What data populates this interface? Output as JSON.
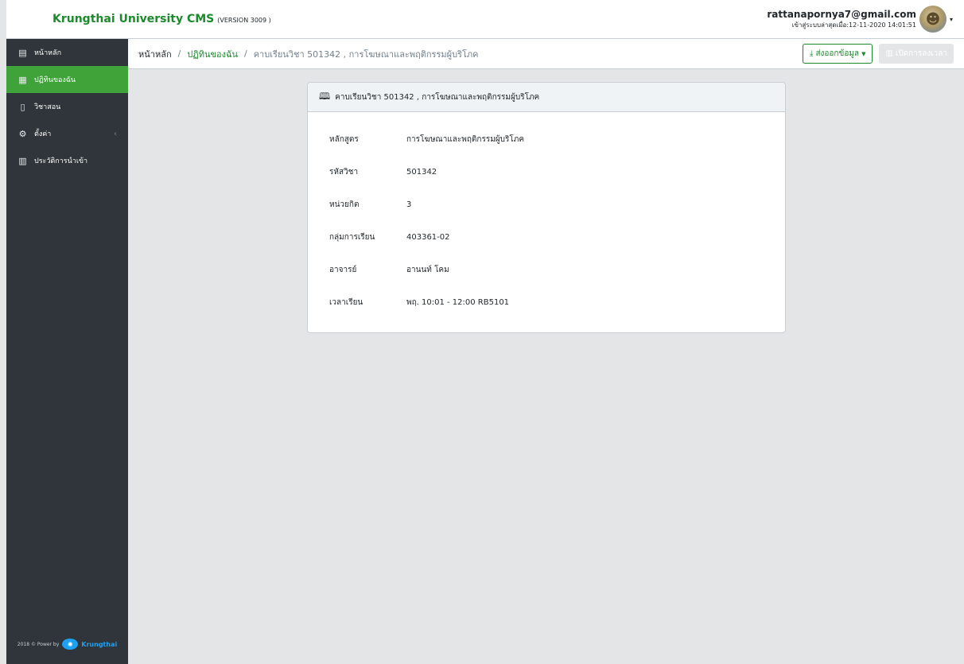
{
  "header": {
    "brand": "Krungthai University CMS",
    "version": "(VERSION 3009 )",
    "user_email": "rattanapornya7@gmail.com",
    "last_login": "เข้าสู่ระบบล่าสุดเมื่อ:12-11-2020 14:01:51",
    "avatar_icon": "user-avatar-icon",
    "caret": "▾"
  },
  "sidebar": {
    "items": [
      {
        "label": "หน้าหลัก",
        "icon": "home-icon",
        "glyph": "▤"
      },
      {
        "label": "ปฏิทินของฉัน",
        "icon": "calendar-icon",
        "glyph": "▦"
      },
      {
        "label": "วิชาสอน",
        "icon": "book-icon",
        "glyph": "▯"
      },
      {
        "label": "ตั้งค่า",
        "icon": "gear-icon",
        "glyph": "⚙"
      },
      {
        "label": "ประวัติการนำเข้า",
        "icon": "clipboard-icon",
        "glyph": "▥"
      }
    ],
    "settings_chevron": "‹",
    "footer_text": "2018 © Power by",
    "footer_brand": "Krungthai",
    "footer_logo_glyph": "✺"
  },
  "breadcrumb": {
    "home": "หน้าหลัก",
    "calendar": "ปฏิทินของฉัน",
    "current": "คาบเรียนวิชา 501342 , การโฆษณาและพฤติกรรมผู้บริโภค",
    "separator": "/"
  },
  "actions": {
    "export_label": "ส่งออกข้อมูล",
    "export_icon_glyph": "⤓",
    "checkin_label": "เปิดการลงเวลา",
    "checkin_icon_glyph": "▥"
  },
  "card": {
    "title": "คาบเรียนวิชา 501342 , การโฆษณาและพฤติกรรมผู้บริโภค",
    "title_icon_glyph": "🕮",
    "rows": [
      {
        "label": "หลักสูตร",
        "value": "การโฆษณาและพฤติกรรมผู้บริโภค"
      },
      {
        "label": "รหัสวิชา",
        "value": "501342"
      },
      {
        "label": "หน่วยกิต",
        "value": "3"
      },
      {
        "label": "กลุ่มการเรียน",
        "value": "403361-02"
      },
      {
        "label": "อาจารย์",
        "value": "อานนท์ โคม"
      },
      {
        "label": "เวลาเรียน",
        "value": "พฤ. 10:01 - 12:00 RB5101"
      }
    ]
  },
  "colors": {
    "brand_green": "#1b8a2b",
    "active_green": "#3fa33a",
    "sidebar_bg": "#2f353a",
    "page_bg": "#e4e5e6"
  }
}
